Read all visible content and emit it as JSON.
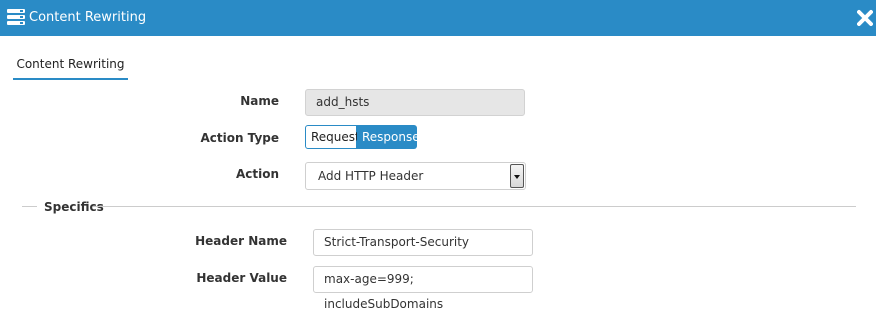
{
  "window": {
    "title": "Content Rewriting",
    "title_icon": "server-rack-icon",
    "close_icon": "close-icon",
    "accent_color": "#2a8bc6"
  },
  "tabs": [
    {
      "label": "Content Rewriting",
      "active": true
    }
  ],
  "form": {
    "name_label": "Name",
    "name_value": "add_hsts",
    "action_type_label": "Action Type",
    "action_type_options": [
      "Request",
      "Response"
    ],
    "action_type_selected": "Response",
    "action_label": "Action",
    "action_value": "Add HTTP Header"
  },
  "specifics": {
    "legend": "Specifics",
    "header_name_label": "Header Name",
    "header_name_value": "Strict-Transport-Security",
    "header_value_label": "Header Value",
    "header_value_value": "max-age=999; includeSubDomains"
  }
}
